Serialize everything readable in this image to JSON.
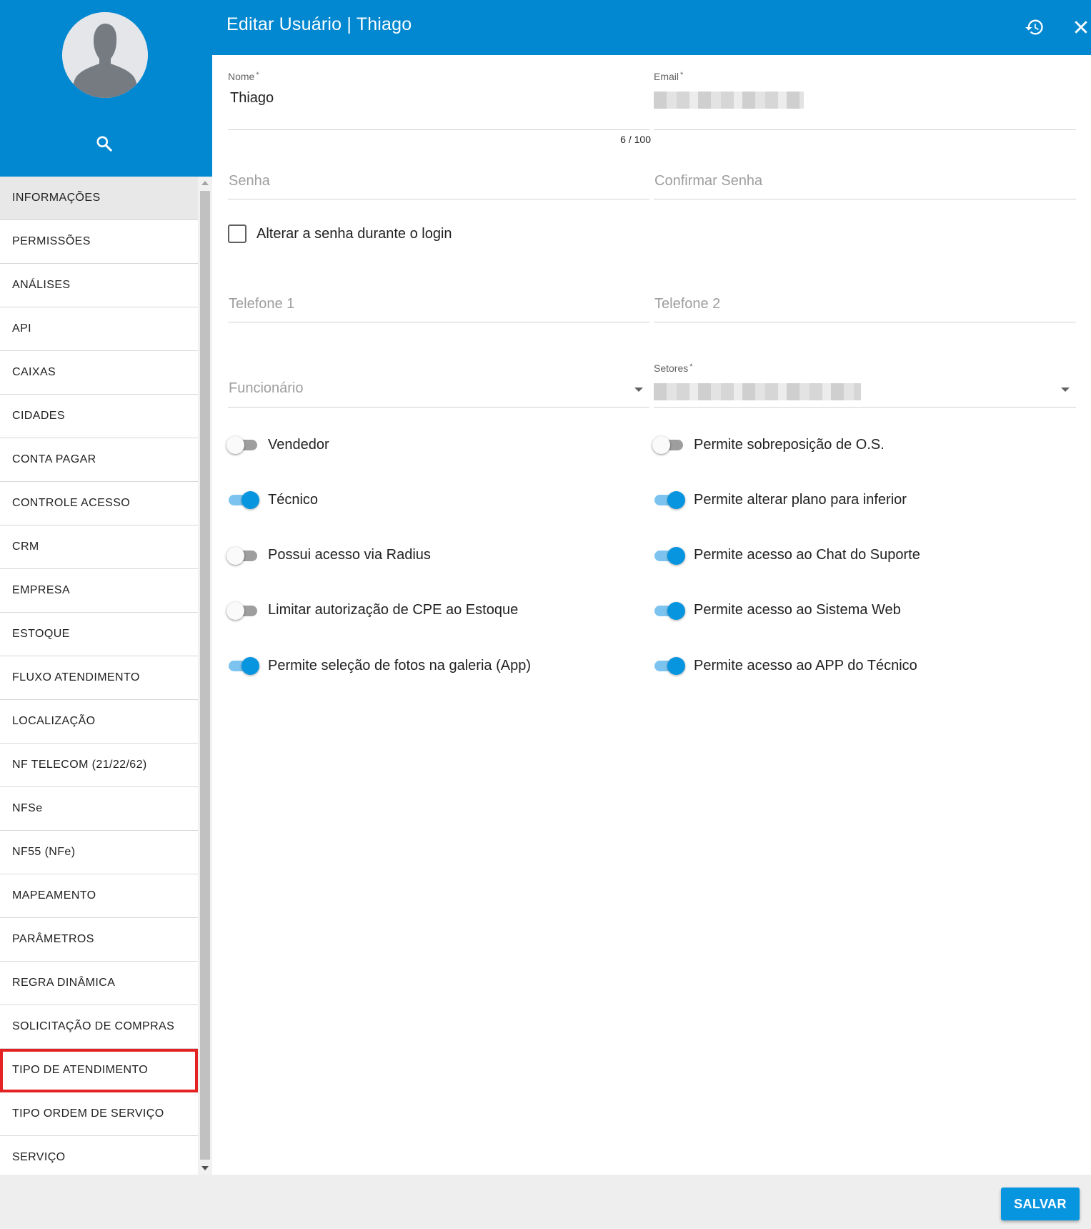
{
  "header": {
    "title": "Editar Usuário | Thiago",
    "history_icon": "history-icon",
    "close_icon": "close-icon"
  },
  "sidebar": {
    "search_icon": "search-icon",
    "items": [
      {
        "label": "INFORMAÇÕES",
        "active": true
      },
      {
        "label": "PERMISSÕES"
      },
      {
        "label": "ANÁLISES"
      },
      {
        "label": "API"
      },
      {
        "label": "CAIXAS"
      },
      {
        "label": "CIDADES"
      },
      {
        "label": "CONTA PAGAR"
      },
      {
        "label": "CONTROLE ACESSO"
      },
      {
        "label": "CRM"
      },
      {
        "label": "EMPRESA"
      },
      {
        "label": "ESTOQUE"
      },
      {
        "label": "FLUXO ATENDIMENTO"
      },
      {
        "label": "LOCALIZAÇÃO"
      },
      {
        "label": "NF TELECOM (21/22/62)"
      },
      {
        "label": "NFSe"
      },
      {
        "label": "NF55 (NFe)"
      },
      {
        "label": "MAPEAMENTO"
      },
      {
        "label": "PARÂMETROS"
      },
      {
        "label": "REGRA DINÂMICA"
      },
      {
        "label": "SOLICITAÇÃO DE COMPRAS"
      },
      {
        "label": "TIPO DE ATENDIMENTO",
        "highlighted": true
      },
      {
        "label": "TIPO ORDEM DE SERVIÇO"
      },
      {
        "label": "SERVIÇO"
      }
    ]
  },
  "form": {
    "nome": {
      "label": "Nome",
      "required": "*",
      "value": "Thiago",
      "counter": "6 / 100"
    },
    "email": {
      "label": "Email",
      "required": "*"
    },
    "senha": {
      "placeholder": "Senha"
    },
    "confirmar_senha": {
      "placeholder": "Confirmar Senha"
    },
    "alterar_senha": {
      "label": "Alterar a senha durante o login",
      "checked": false
    },
    "telefone1": {
      "placeholder": "Telefone 1"
    },
    "telefone2": {
      "placeholder": "Telefone 2"
    },
    "funcionario": {
      "placeholder": "Funcionário"
    },
    "setores": {
      "label": "Setores",
      "required": "*"
    },
    "toggles_left": [
      {
        "label": "Vendedor",
        "on": false
      },
      {
        "label": "Técnico",
        "on": true
      },
      {
        "label": "Possui acesso via Radius",
        "on": false
      },
      {
        "label": "Limitar autorização de CPE ao Estoque",
        "on": false
      },
      {
        "label": "Permite seleção de fotos na galeria (App)",
        "on": true
      }
    ],
    "toggles_right": [
      {
        "label": "Permite sobreposição de O.S.",
        "on": false
      },
      {
        "label": "Permite alterar plano para inferior",
        "on": true
      },
      {
        "label": "Permite acesso ao Chat do Suporte",
        "on": true
      },
      {
        "label": "Permite acesso ao Sistema Web",
        "on": true
      },
      {
        "label": "Permite acesso ao APP do Técnico",
        "on": true
      }
    ]
  },
  "footer": {
    "save_label": "SALVAR"
  },
  "colors": {
    "primary": "#0288d1",
    "accent": "#0795e0",
    "highlight": "#e52222"
  }
}
